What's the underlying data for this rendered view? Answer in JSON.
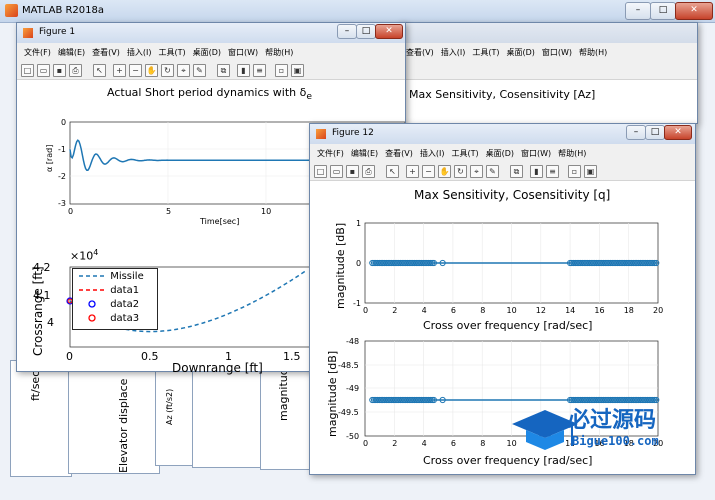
{
  "main_window": {
    "title": "MATLAB R2018a"
  },
  "menu": [
    "文件(F)",
    "编辑(E)",
    "查看(V)",
    "插入(I)",
    "工具(T)",
    "桌面(D)",
    "窗口(W)",
    "帮助(H)"
  ],
  "figure1": {
    "title": "Figure 1",
    "top_plot": {
      "title": "Actual Short period dynamics with δe",
      "title_main": "Actual Short period dynamics with δ",
      "title_sub": "e",
      "ylabel": "α [rad]",
      "xlabel": "Time[sec]",
      "yticks": [
        "0",
        "-1",
        "-2",
        "-3"
      ],
      "xticks": [
        "0",
        "5",
        "10"
      ]
    },
    "bottom_plot": {
      "ylabel": "Crossrange [ft]",
      "xlabel": "Downrange [ft]",
      "exponent": "×10",
      "exponent_power": "4",
      "yticks": [
        "4.2",
        "4.1",
        "4"
      ],
      "xticks": [
        "0",
        "0.5",
        "1",
        "1.5"
      ],
      "legend": [
        "Missile",
        "data1",
        "data2",
        "data3"
      ]
    }
  },
  "figure_behind": {
    "title": "Max Sensitivity, Cosensitivity [Az]"
  },
  "figure12": {
    "title": "Figure 12",
    "plot_title": "Max Sensitivity, Cosensitivity [q]",
    "top_plot": {
      "ylabel": "magnitude [dB]",
      "xlabel": "Cross over frequency [rad/sec]",
      "yticks": [
        "1",
        "0",
        "-1"
      ],
      "xticks": [
        "0",
        "2",
        "4",
        "6",
        "8",
        "10",
        "12",
        "14",
        "16",
        "18",
        "20"
      ]
    },
    "bottom_plot": {
      "ylabel": "magnitude [dB]",
      "xlabel": "Cross over frequency [rad/sec]",
      "yticks": [
        "-48",
        "-48.5",
        "-49",
        "-49.5",
        "-50"
      ],
      "xticks": [
        "0",
        "2",
        "4",
        "6",
        "8",
        "10",
        "12",
        "14",
        "16",
        "18",
        "20"
      ]
    }
  },
  "background_labels": {
    "a": "ft/sec²",
    "b": "Elevator displace",
    "c": "Az (ft/s2)",
    "d": "magnitude"
  },
  "watermark": {
    "brand": "必过源码",
    "url": "Bigue100.com"
  },
  "colors": {
    "line": "#1f77b4",
    "data2": "#0000ff",
    "data3": "#ff0000",
    "accent": "#d9431d"
  }
}
